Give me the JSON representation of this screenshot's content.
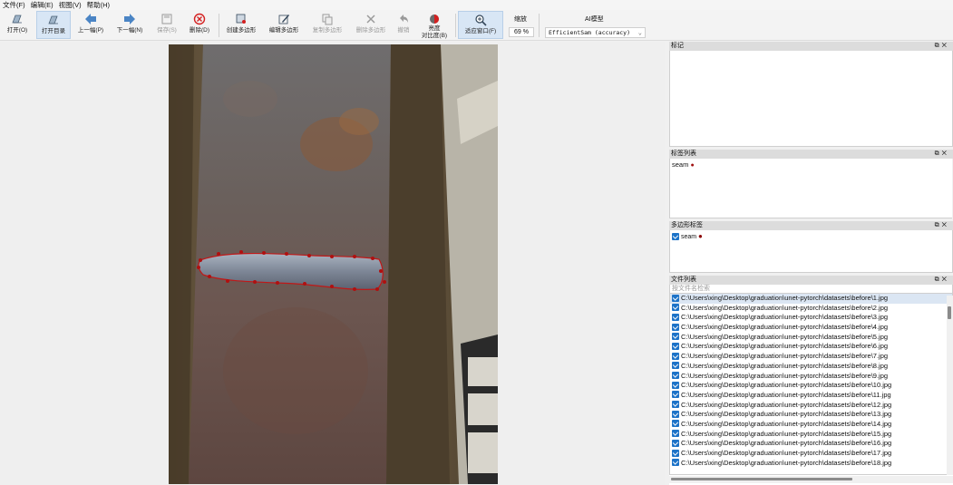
{
  "menu": [
    "文件(F)",
    "编辑(E)",
    "视图(V)",
    "帮助(H)"
  ],
  "toolbar": {
    "open": "打开(O)",
    "open_dir": "打开目录",
    "prev": "上一幅(P)",
    "next": "下一幅(N)",
    "save": "保存(S)",
    "delete": "删除(D)",
    "create_polygon": "创建多边形",
    "edit_polygon": "编辑多边形",
    "copy_polygon": "复制多边形",
    "delete_polygon": "删除多边形",
    "undo": "撤销",
    "brightness_1": "亮度",
    "brightness_2": "对比度(B)",
    "fit_window": "适应窗口(F)",
    "zoom_label": "缩放",
    "zoom_value": "69 %",
    "ai_label": "AI模型",
    "ai_model": "EfficientSam (accuracy)"
  },
  "panels": {
    "flags_title": "标记",
    "labels_title": "标签列表",
    "labels": [
      {
        "name": "seam",
        "color": "#a01010"
      }
    ],
    "polygons_title": "多边形标签",
    "polygons": [
      {
        "name": "seam",
        "color": "#8b0000"
      }
    ],
    "files_title": "文件列表",
    "search_placeholder": "按文件名检索",
    "files": [
      "C:\\Users\\xing\\Desktop\\graduation\\unet-pytorch\\datasets\\before\\1.jpg",
      "C:\\Users\\xing\\Desktop\\graduation\\unet-pytorch\\datasets\\before\\2.jpg",
      "C:\\Users\\xing\\Desktop\\graduation\\unet-pytorch\\datasets\\before\\3.jpg",
      "C:\\Users\\xing\\Desktop\\graduation\\unet-pytorch\\datasets\\before\\4.jpg",
      "C:\\Users\\xing\\Desktop\\graduation\\unet-pytorch\\datasets\\before\\5.jpg",
      "C:\\Users\\xing\\Desktop\\graduation\\unet-pytorch\\datasets\\before\\6.jpg",
      "C:\\Users\\xing\\Desktop\\graduation\\unet-pytorch\\datasets\\before\\7.jpg",
      "C:\\Users\\xing\\Desktop\\graduation\\unet-pytorch\\datasets\\before\\8.jpg",
      "C:\\Users\\xing\\Desktop\\graduation\\unet-pytorch\\datasets\\before\\9.jpg",
      "C:\\Users\\xing\\Desktop\\graduation\\unet-pytorch\\datasets\\before\\10.jpg",
      "C:\\Users\\xing\\Desktop\\graduation\\unet-pytorch\\datasets\\before\\11.jpg",
      "C:\\Users\\xing\\Desktop\\graduation\\unet-pytorch\\datasets\\before\\12.jpg",
      "C:\\Users\\xing\\Desktop\\graduation\\unet-pytorch\\datasets\\before\\13.jpg",
      "C:\\Users\\xing\\Desktop\\graduation\\unet-pytorch\\datasets\\before\\14.jpg",
      "C:\\Users\\xing\\Desktop\\graduation\\unet-pytorch\\datasets\\before\\15.jpg",
      "C:\\Users\\xing\\Desktop\\graduation\\unet-pytorch\\datasets\\before\\16.jpg",
      "C:\\Users\\xing\\Desktop\\graduation\\unet-pytorch\\datasets\\before\\17.jpg",
      "C:\\Users\\xing\\Desktop\\graduation\\unet-pytorch\\datasets\\before\\18.jpg"
    ]
  },
  "colors": {
    "accent": "#1d73c8",
    "polygon": "#c01818"
  }
}
